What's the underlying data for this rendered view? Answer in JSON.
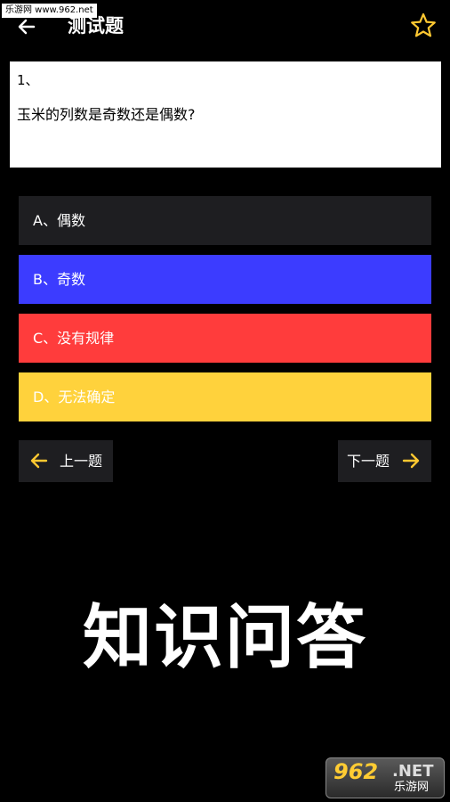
{
  "watermark_top": "乐游网 www.962.net",
  "header": {
    "title": "测试题",
    "back_icon": "arrow-left-icon",
    "favorite_icon": "star-outline-icon"
  },
  "question": {
    "number": "1、",
    "text": "玉米的列数是奇数还是偶数?"
  },
  "options": [
    {
      "label": "A、偶数",
      "color": "#1e1e21"
    },
    {
      "label": "B、奇数",
      "color": "#3c3cff"
    },
    {
      "label": "C、没有规律",
      "color": "#ff3c3c"
    },
    {
      "label": "D、无法确定",
      "color": "#ffd23c"
    }
  ],
  "nav": {
    "prev_label": "上一题",
    "next_label": "下一题",
    "prev_icon": "arrow-left-icon",
    "next_icon": "arrow-right-icon",
    "accent": "#ffc831"
  },
  "banner": "知识问答",
  "logo": {
    "number": "962",
    "suffix": ".NET",
    "sub": "乐游网"
  }
}
